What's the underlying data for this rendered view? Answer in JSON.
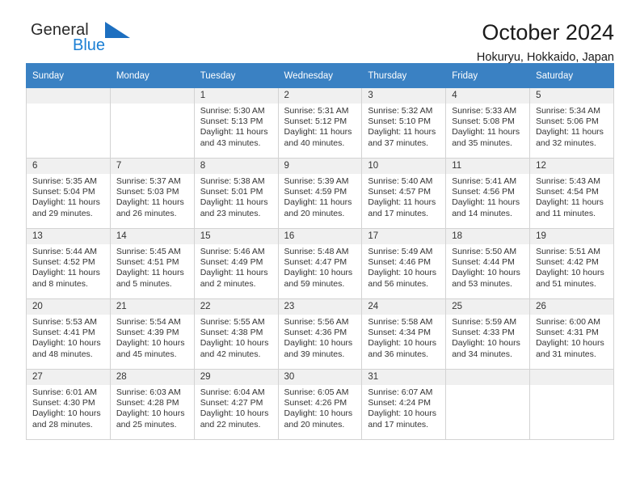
{
  "brand": {
    "name_part1": "General",
    "name_part2": "Blue",
    "logo_icon": "triangle-logo-icon"
  },
  "header": {
    "title": "October 2024",
    "location": "Hokuryu, Hokkaido, Japan"
  },
  "calendar": {
    "weekday_headers": [
      "Sunday",
      "Monday",
      "Tuesday",
      "Wednesday",
      "Thursday",
      "Friday",
      "Saturday"
    ],
    "labels": {
      "sunrise_prefix": "Sunrise: ",
      "sunset_prefix": "Sunset: ",
      "daylight_prefix": "Daylight: "
    },
    "weeks": [
      [
        {
          "day": "",
          "empty": true
        },
        {
          "day": "",
          "empty": true
        },
        {
          "day": "1",
          "sunrise": "Sunrise: 5:30 AM",
          "sunset": "Sunset: 5:13 PM",
          "daylight": "Daylight: 11 hours and 43 minutes."
        },
        {
          "day": "2",
          "sunrise": "Sunrise: 5:31 AM",
          "sunset": "Sunset: 5:12 PM",
          "daylight": "Daylight: 11 hours and 40 minutes."
        },
        {
          "day": "3",
          "sunrise": "Sunrise: 5:32 AM",
          "sunset": "Sunset: 5:10 PM",
          "daylight": "Daylight: 11 hours and 37 minutes."
        },
        {
          "day": "4",
          "sunrise": "Sunrise: 5:33 AM",
          "sunset": "Sunset: 5:08 PM",
          "daylight": "Daylight: 11 hours and 35 minutes."
        },
        {
          "day": "5",
          "sunrise": "Sunrise: 5:34 AM",
          "sunset": "Sunset: 5:06 PM",
          "daylight": "Daylight: 11 hours and 32 minutes."
        }
      ],
      [
        {
          "day": "6",
          "sunrise": "Sunrise: 5:35 AM",
          "sunset": "Sunset: 5:04 PM",
          "daylight": "Daylight: 11 hours and 29 minutes."
        },
        {
          "day": "7",
          "sunrise": "Sunrise: 5:37 AM",
          "sunset": "Sunset: 5:03 PM",
          "daylight": "Daylight: 11 hours and 26 minutes."
        },
        {
          "day": "8",
          "sunrise": "Sunrise: 5:38 AM",
          "sunset": "Sunset: 5:01 PM",
          "daylight": "Daylight: 11 hours and 23 minutes."
        },
        {
          "day": "9",
          "sunrise": "Sunrise: 5:39 AM",
          "sunset": "Sunset: 4:59 PM",
          "daylight": "Daylight: 11 hours and 20 minutes."
        },
        {
          "day": "10",
          "sunrise": "Sunrise: 5:40 AM",
          "sunset": "Sunset: 4:57 PM",
          "daylight": "Daylight: 11 hours and 17 minutes."
        },
        {
          "day": "11",
          "sunrise": "Sunrise: 5:41 AM",
          "sunset": "Sunset: 4:56 PM",
          "daylight": "Daylight: 11 hours and 14 minutes."
        },
        {
          "day": "12",
          "sunrise": "Sunrise: 5:43 AM",
          "sunset": "Sunset: 4:54 PM",
          "daylight": "Daylight: 11 hours and 11 minutes."
        }
      ],
      [
        {
          "day": "13",
          "sunrise": "Sunrise: 5:44 AM",
          "sunset": "Sunset: 4:52 PM",
          "daylight": "Daylight: 11 hours and 8 minutes."
        },
        {
          "day": "14",
          "sunrise": "Sunrise: 5:45 AM",
          "sunset": "Sunset: 4:51 PM",
          "daylight": "Daylight: 11 hours and 5 minutes."
        },
        {
          "day": "15",
          "sunrise": "Sunrise: 5:46 AM",
          "sunset": "Sunset: 4:49 PM",
          "daylight": "Daylight: 11 hours and 2 minutes."
        },
        {
          "day": "16",
          "sunrise": "Sunrise: 5:48 AM",
          "sunset": "Sunset: 4:47 PM",
          "daylight": "Daylight: 10 hours and 59 minutes."
        },
        {
          "day": "17",
          "sunrise": "Sunrise: 5:49 AM",
          "sunset": "Sunset: 4:46 PM",
          "daylight": "Daylight: 10 hours and 56 minutes."
        },
        {
          "day": "18",
          "sunrise": "Sunrise: 5:50 AM",
          "sunset": "Sunset: 4:44 PM",
          "daylight": "Daylight: 10 hours and 53 minutes."
        },
        {
          "day": "19",
          "sunrise": "Sunrise: 5:51 AM",
          "sunset": "Sunset: 4:42 PM",
          "daylight": "Daylight: 10 hours and 51 minutes."
        }
      ],
      [
        {
          "day": "20",
          "sunrise": "Sunrise: 5:53 AM",
          "sunset": "Sunset: 4:41 PM",
          "daylight": "Daylight: 10 hours and 48 minutes."
        },
        {
          "day": "21",
          "sunrise": "Sunrise: 5:54 AM",
          "sunset": "Sunset: 4:39 PM",
          "daylight": "Daylight: 10 hours and 45 minutes."
        },
        {
          "day": "22",
          "sunrise": "Sunrise: 5:55 AM",
          "sunset": "Sunset: 4:38 PM",
          "daylight": "Daylight: 10 hours and 42 minutes."
        },
        {
          "day": "23",
          "sunrise": "Sunrise: 5:56 AM",
          "sunset": "Sunset: 4:36 PM",
          "daylight": "Daylight: 10 hours and 39 minutes."
        },
        {
          "day": "24",
          "sunrise": "Sunrise: 5:58 AM",
          "sunset": "Sunset: 4:34 PM",
          "daylight": "Daylight: 10 hours and 36 minutes."
        },
        {
          "day": "25",
          "sunrise": "Sunrise: 5:59 AM",
          "sunset": "Sunset: 4:33 PM",
          "daylight": "Daylight: 10 hours and 34 minutes."
        },
        {
          "day": "26",
          "sunrise": "Sunrise: 6:00 AM",
          "sunset": "Sunset: 4:31 PM",
          "daylight": "Daylight: 10 hours and 31 minutes."
        }
      ],
      [
        {
          "day": "27",
          "sunrise": "Sunrise: 6:01 AM",
          "sunset": "Sunset: 4:30 PM",
          "daylight": "Daylight: 10 hours and 28 minutes."
        },
        {
          "day": "28",
          "sunrise": "Sunrise: 6:03 AM",
          "sunset": "Sunset: 4:28 PM",
          "daylight": "Daylight: 10 hours and 25 minutes."
        },
        {
          "day": "29",
          "sunrise": "Sunrise: 6:04 AM",
          "sunset": "Sunset: 4:27 PM",
          "daylight": "Daylight: 10 hours and 22 minutes."
        },
        {
          "day": "30",
          "sunrise": "Sunrise: 6:05 AM",
          "sunset": "Sunset: 4:26 PM",
          "daylight": "Daylight: 10 hours and 20 minutes."
        },
        {
          "day": "31",
          "sunrise": "Sunrise: 6:07 AM",
          "sunset": "Sunset: 4:24 PM",
          "daylight": "Daylight: 10 hours and 17 minutes."
        },
        {
          "day": "",
          "empty": true
        },
        {
          "day": "",
          "empty": true
        }
      ]
    ]
  },
  "colors": {
    "header_blue": "#3a81c3",
    "brand_blue": "#1b7fd4",
    "cell_shade": "#f0f0f0",
    "grid_line": "#d3d3d3"
  }
}
